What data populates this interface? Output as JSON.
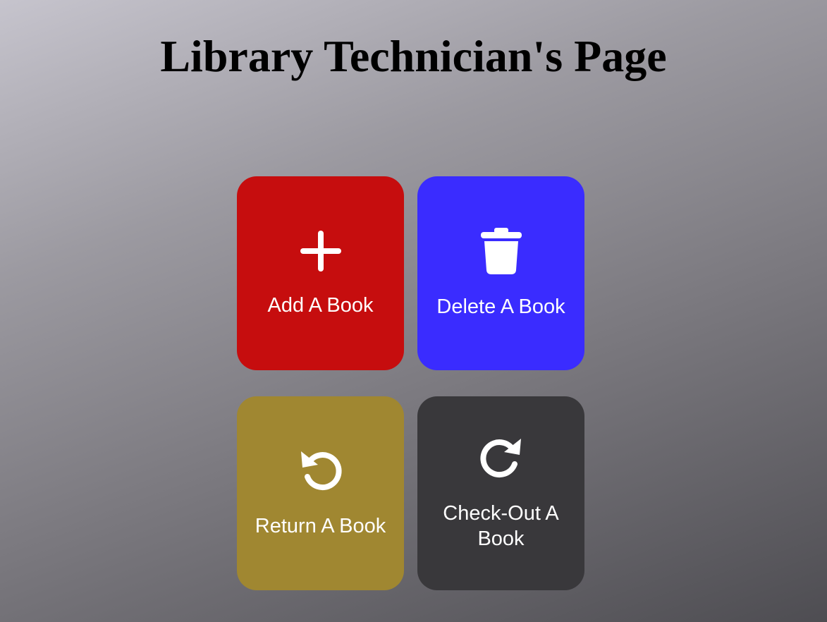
{
  "page": {
    "title": "Library Technician's Page"
  },
  "tiles": [
    {
      "id": "add",
      "label": "Add A Book",
      "icon": "plus-icon",
      "color": "#c60d0e"
    },
    {
      "id": "delete",
      "label": "Delete A Book",
      "icon": "trash-icon",
      "color": "#3a2cff"
    },
    {
      "id": "return",
      "label": "Return A Book",
      "icon": "rotate-left-icon",
      "color": "#a08731"
    },
    {
      "id": "checkout",
      "label": "Check-Out A Book",
      "icon": "rotate-right-icon",
      "color": "#39383b"
    }
  ]
}
